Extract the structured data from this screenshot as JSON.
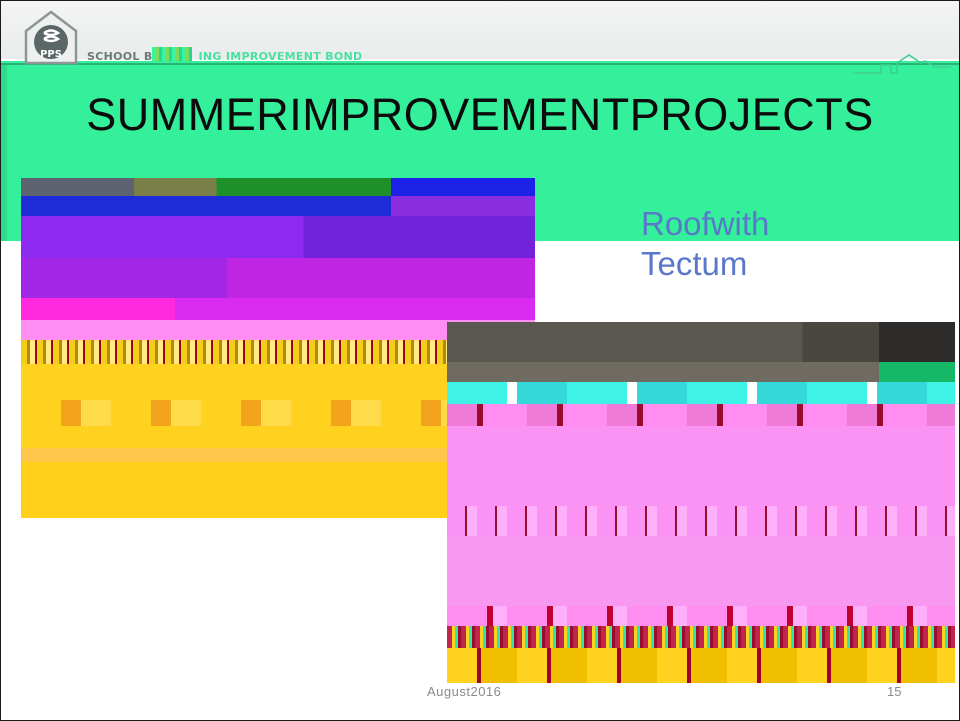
{
  "header": {
    "logo_text": "PPS",
    "bond_prefix": "SCHOOL B",
    "bond_suffix": "ING IMPROVEMENT BOND"
  },
  "title": {
    "text": "SUMMERIMPROVEMENTPROJECTS"
  },
  "caption": {
    "line1": "Roofwith",
    "line2": "Tectum"
  },
  "footer": {
    "date": "August2016",
    "page_number": "15"
  },
  "colors": {
    "title_band": "#34f09a",
    "caption": "#5a78c9",
    "footer_text": "#8a8a8a"
  },
  "icons": {
    "logo": "pps-house-logo-icon",
    "house_outline": "house-outline-icon"
  }
}
